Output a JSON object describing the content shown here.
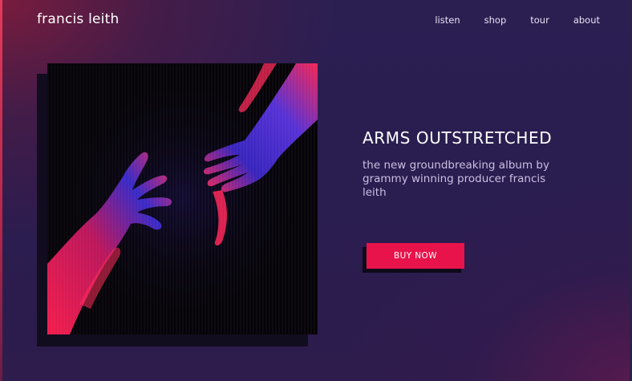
{
  "brand": {
    "name": "francis leith"
  },
  "nav": {
    "items": [
      {
        "label": "listen"
      },
      {
        "label": "shop"
      },
      {
        "label": "tour"
      },
      {
        "label": "about"
      }
    ]
  },
  "hero": {
    "title": "ARMS OUTSTRETCHED",
    "subtitle": "the new groundbreaking album by grammy winning producer francis leith",
    "cta_label": "BUY NOW"
  },
  "album_art": {
    "icon": "reaching-hands-image"
  },
  "colors": {
    "accent": "#e8134a",
    "background": "#2a1d50",
    "text": "#ffffff",
    "subtext": "#c9bfe0"
  }
}
